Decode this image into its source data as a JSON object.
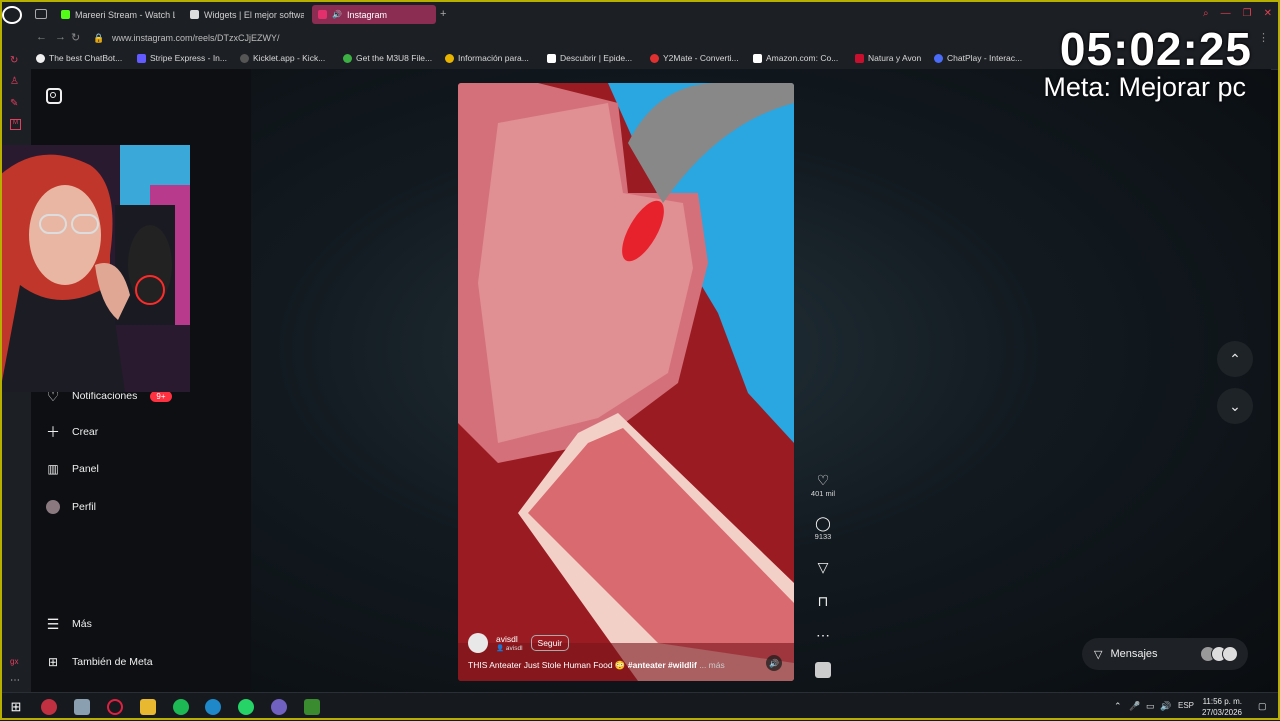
{
  "browser": {
    "tabs": [
      {
        "label": "Mareeri Stream - Watch Li",
        "active": false,
        "color": "#53fc18"
      },
      {
        "label": "Widgets | El mejor softwa",
        "active": false,
        "color": "#dddddd"
      },
      {
        "label": "Instagram",
        "active": true,
        "color": "#e1306c"
      }
    ],
    "new_tab": "+",
    "url": "www.instagram.com/reels/DTzxCJjEZWY/",
    "bookmarks": [
      {
        "label": "The best ChatBot...",
        "color": "#f0f0f0"
      },
      {
        "label": "Stripe Express - In...",
        "color": "#635bff"
      },
      {
        "label": "Kicklet.app - Kick...",
        "color": "#333333"
      },
      {
        "label": "Get the M3U8 File...",
        "color": "#3cb043"
      },
      {
        "label": "Información para...",
        "color": "#e8b400"
      },
      {
        "label": "Descubrir | Epide...",
        "color": "#ffffff"
      },
      {
        "label": "Y2Mate - Converti...",
        "color": "#e03030"
      },
      {
        "label": "Amazon.com: Co...",
        "color": "#ffffff"
      },
      {
        "label": "Natura y Avon",
        "color": "#c8102e"
      },
      {
        "label": "ChatPlay - Interac...",
        "color": "#4a6cf7"
      }
    ]
  },
  "overlay": {
    "timer": "05:02:25",
    "goal": "Meta: Mejorar pc"
  },
  "sidebar": {
    "items": [
      {
        "label": "Notificaciones",
        "icon": "heart-icon",
        "badge": "9+"
      },
      {
        "label": "Crear",
        "icon": "plus-icon"
      },
      {
        "label": "Panel",
        "icon": "chart-icon"
      },
      {
        "label": "Perfil",
        "icon": "avatar-icon"
      },
      {
        "label": "Más",
        "icon": "menu-icon"
      },
      {
        "label": "También de Meta",
        "icon": "meta-grid-icon"
      }
    ]
  },
  "reel": {
    "author": "avisdl",
    "author_sub": "avisdl",
    "follow_label": "Seguir",
    "caption_text": "THIS Anteater Just Stole Human Food 😳",
    "caption_tags": "#anteater #wildlif",
    "caption_more": "... más",
    "likes": "401 mil",
    "comments": "9133"
  },
  "messages": {
    "label": "Mensajes"
  },
  "taskbar": {
    "language": "ESP",
    "time": "11:56 p. m.",
    "date": "27/03/2026"
  }
}
